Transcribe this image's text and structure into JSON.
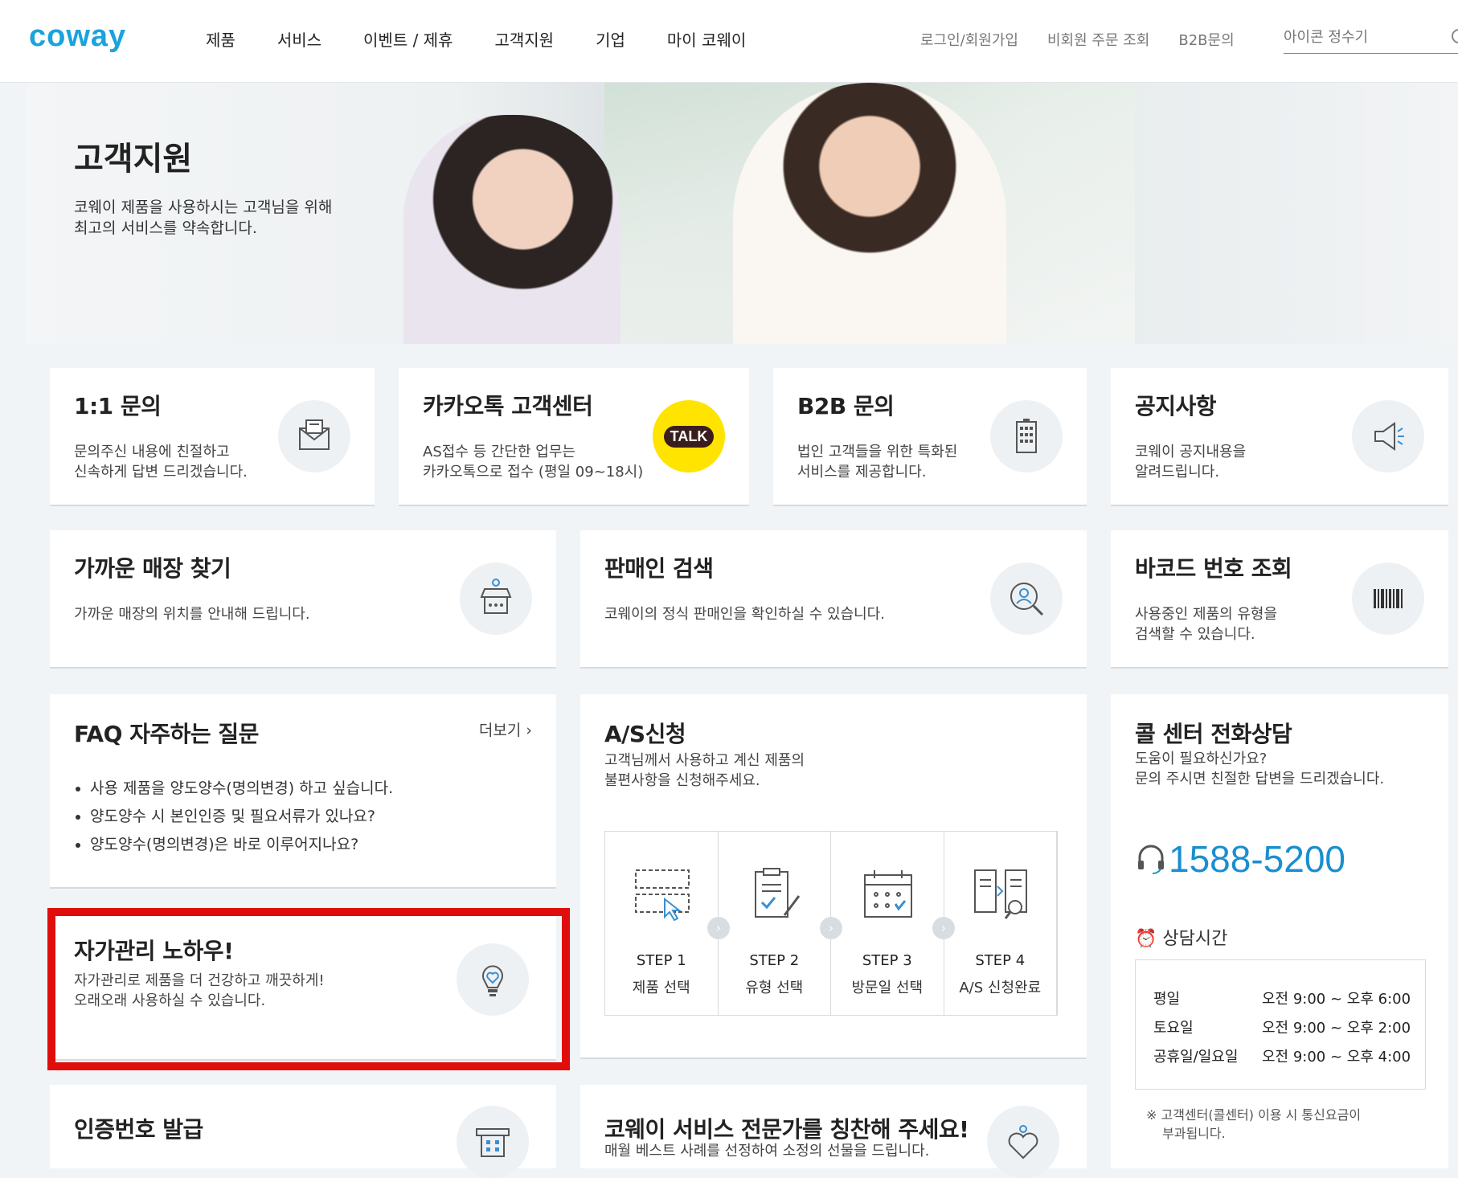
{
  "header": {
    "logo": "coway",
    "nav": [
      "제품",
      "서비스",
      "이벤트 / 제휴",
      "고객지원",
      "기업",
      "마이 코웨이"
    ],
    "util": [
      "로그인/회원가입",
      "비회원 주문 조회",
      "B2B문의"
    ],
    "search_placeholder": "아이콘 정수기"
  },
  "hero": {
    "title": "고객지원",
    "desc_line1": "코웨이 제품을 사용하시는 고객님을 위해",
    "desc_line2": "최고의 서비스를 약속합니다."
  },
  "cards": {
    "inquiry": {
      "title": "1:1 문의",
      "d1": "문의주신 내용에 친절하고",
      "d2": "신속하게 답변 드리겠습니다.",
      "icon": "mail-icon"
    },
    "kakao": {
      "title": "카카오톡 고객센터",
      "d1": "AS접수 등 간단한 업무는",
      "d2": "카카오톡으로 접수 (평일 09~18시)",
      "badge": "TALK"
    },
    "b2b": {
      "title": "B2B 문의",
      "d1": "법인 고객들을 위한 특화된",
      "d2": "서비스를 제공합니다.",
      "icon": "building-icon"
    },
    "notice": {
      "title": "공지사항",
      "d1": "코웨이 공지내용을",
      "d2": "알려드립니다.",
      "icon": "megaphone-icon"
    },
    "store": {
      "title": "가까운 매장 찾기",
      "d1": "가까운 매장의 위치를 안내해 드립니다.",
      "icon": "store-icon"
    },
    "seller": {
      "title": "판매인 검색",
      "d1": "코웨이의 정식 판매인을 확인하실 수 있습니다.",
      "icon": "person-search-icon"
    },
    "barcode": {
      "title": "바코드 번호 조회",
      "d1": "사용중인 제품의 유형을",
      "d2": "검색할 수 있습니다.",
      "icon": "barcode-icon"
    },
    "faq": {
      "title": "FAQ 자주하는 질문",
      "more": "더보기",
      "items": [
        "사용 제품을 양도양수(명의변경) 하고 싶습니다.",
        "양도양수 시 본인인증 및 필요서류가 있나요?",
        "양도양수(명의변경)은 바로 이루어지나요?"
      ]
    },
    "as": {
      "title": "A/S신청",
      "d1": "고객님께서 사용하고 계신 제품의",
      "d2": "불편사항을 신청해주세요.",
      "steps": [
        {
          "num": "STEP 1",
          "label": "제품 선택"
        },
        {
          "num": "STEP 2",
          "label": "유형 선택"
        },
        {
          "num": "STEP 3",
          "label": "방문일 선택"
        },
        {
          "num": "STEP 4",
          "label": "A/S 신청완료"
        }
      ]
    },
    "call": {
      "title": "콜 센터 전화상담",
      "d1": "도움이 필요하신가요?",
      "d2": "문의 주시면 친절한 답변을 드리겠습니다.",
      "number": "1588-5200",
      "hours_title": "상담시간",
      "hours": [
        {
          "day": "평일",
          "time": "오전 9:00 ~ 오후 6:00"
        },
        {
          "day": "토요일",
          "time": "오전 9:00 ~ 오후 2:00"
        },
        {
          "day": "공휴일/일요일",
          "time": "오전 9:00 ~ 오후 4:00"
        }
      ],
      "note1": "※ 고객센터(콜센터) 이용 시 통신요금이",
      "note2": "부과됩니다."
    },
    "selfcare": {
      "title": "자가관리 노하우!",
      "d1": "자가관리로 제품을 더 건강하고 깨끗하게!",
      "d2": "오래오래 사용하실 수 있습니다.",
      "icon": "lightbulb-heart-icon"
    },
    "auth": {
      "title": "인증번호 발급",
      "icon": "atm-icon"
    },
    "praise": {
      "title": "코웨이 서비스 전문가를 칭찬해 주세요!",
      "d1": "매월 베스트 사례를 선정하여 소정의 선물을 드립니다.",
      "icon": "heart-person-icon"
    }
  },
  "colors": {
    "accent": "#1aa3dc",
    "phone": "#1a8fd0",
    "highlight": "#e00d0d",
    "kakao": "#ffe400"
  }
}
